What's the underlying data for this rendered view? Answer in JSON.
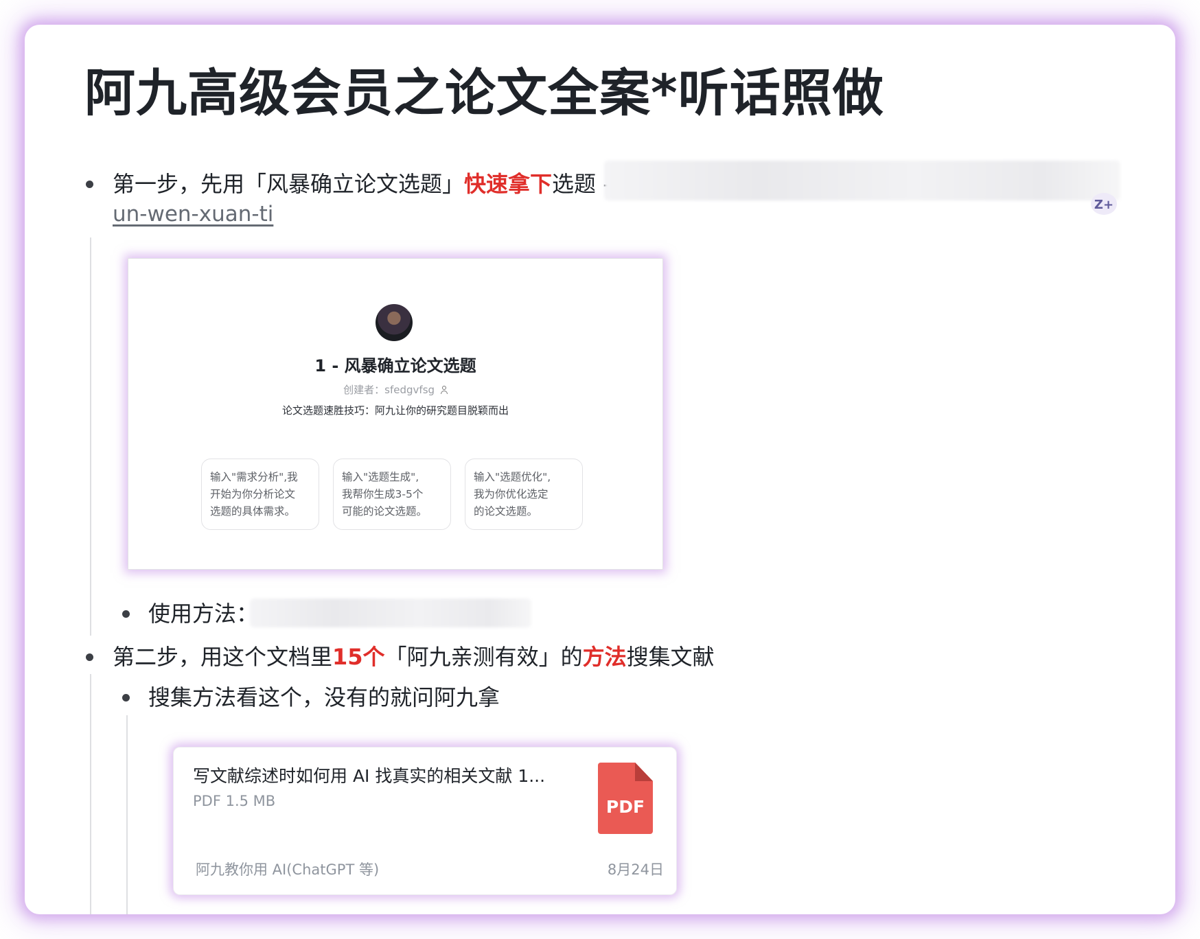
{
  "page": {
    "title": "阿九高级会员之论文全案*听话照做"
  },
  "step1": {
    "prefix": "第一步，先用「风暴确立论文选题」",
    "highlight": "快速拿下",
    "suffix": "选题 -",
    "link_text": "un-wen-xuan-ti",
    "corner_badge": "Z+"
  },
  "gpt_card": {
    "title": "1 - 风暴确立论文选题",
    "creator_label": "创建者：",
    "creator_name": "sfedgvfsg",
    "creator_icon": "person-icon",
    "description": "论文选题速胜技巧：阿九让你的研究题目脱颖而出",
    "starters": [
      "输入\"需求分析\",我\n开始为你分析论文\n选题的具体需求。",
      "输入\"选题生成\",\n我帮你生成3-5个\n可能的论文选题。",
      "输入\"选题优化\",\n我为你优化选定\n的论文选题。"
    ]
  },
  "usage": {
    "label": "使用方法："
  },
  "step2": {
    "part1": "第二步，用这个文档里",
    "highlight1": "15个",
    "part2": "「阿九亲测有效」的",
    "highlight2": "方法",
    "part3": "搜集文献"
  },
  "sub_bullet": {
    "text": "搜集方法看这个，没有的就问阿九拿"
  },
  "pdf_card": {
    "file_name": "写文献综述时如何用 AI 找真实的相关文献 1...",
    "meta": "PDF 1.5 MB",
    "icon_label": "PDF",
    "source": "阿九教你用 AI(ChatGPT 等)",
    "date": "8月24日"
  }
}
